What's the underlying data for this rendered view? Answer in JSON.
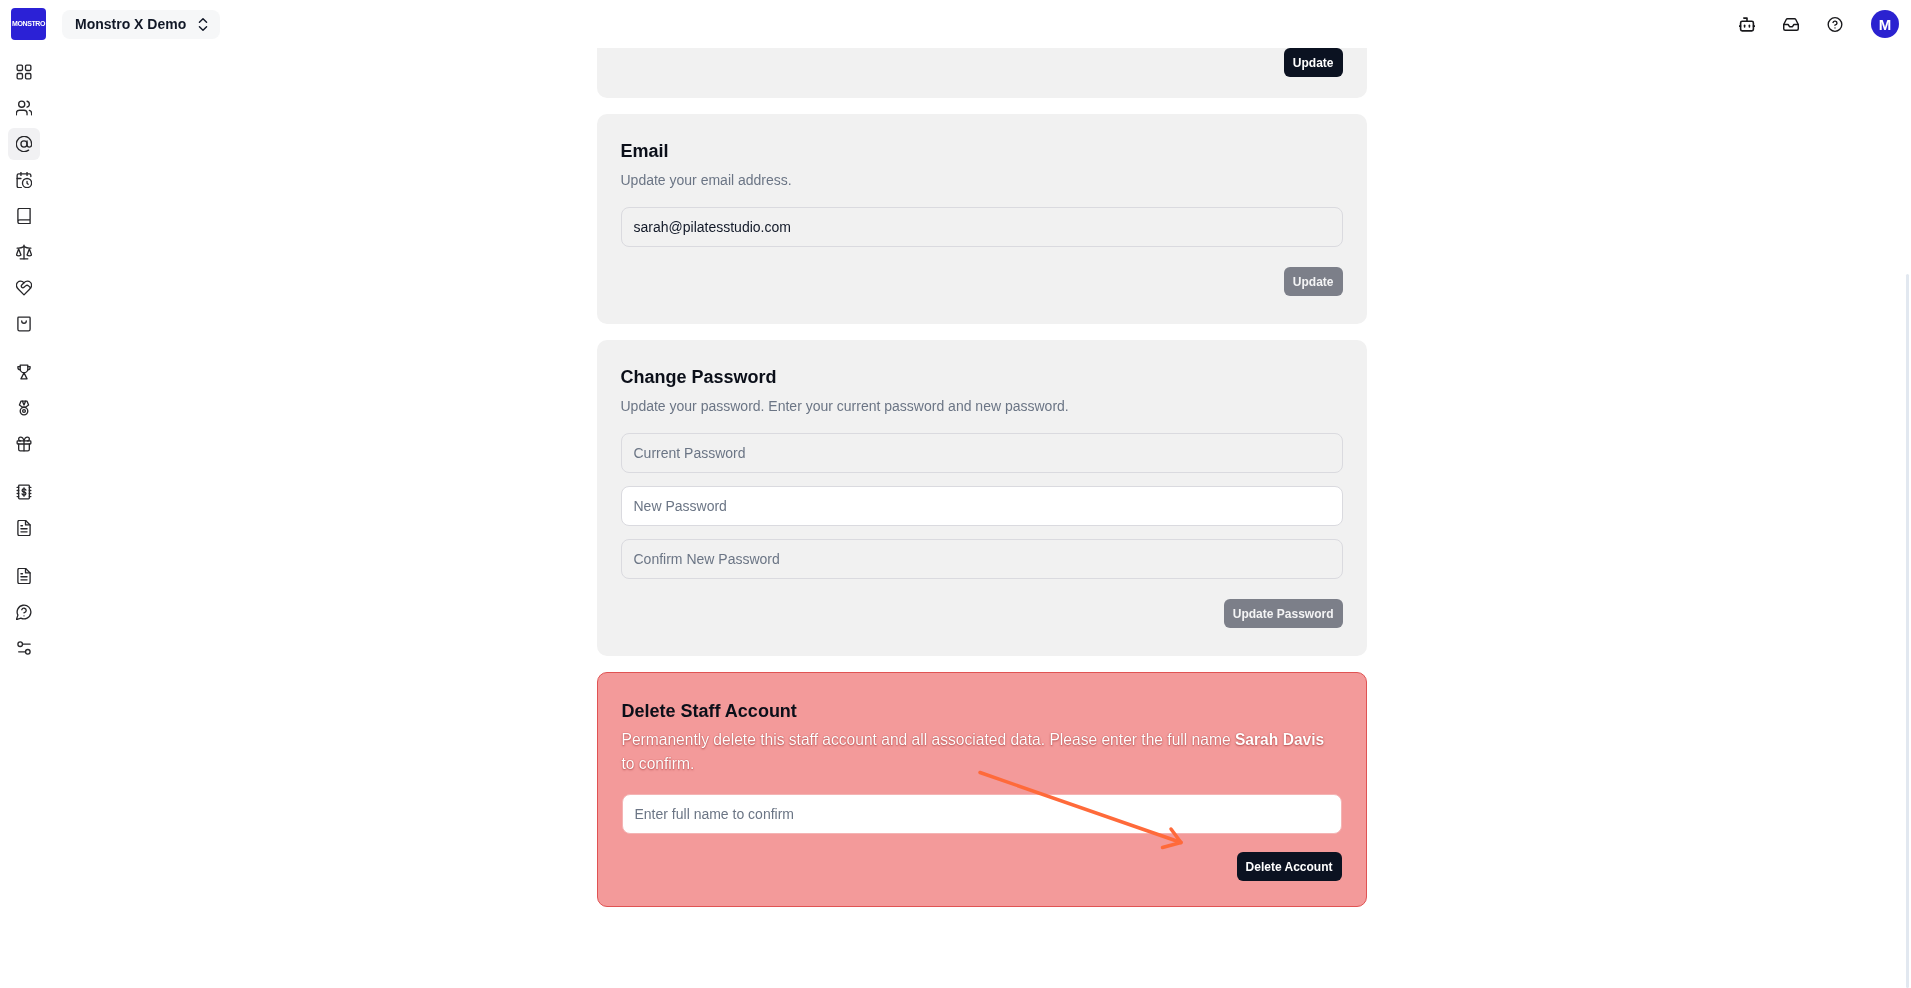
{
  "header": {
    "logo": "MONSTRO",
    "project": "Monstro X Demo",
    "avatar": "M"
  },
  "sidebar": {
    "groups": [
      {
        "items": [
          {
            "selected": false
          },
          {
            "selected": false
          },
          {
            "selected": true
          },
          {
            "selected": false
          },
          {
            "selected": false
          },
          {
            "selected": false
          },
          {
            "selected": false
          },
          {
            "selected": false
          }
        ]
      },
      {
        "items": [
          {
            "selected": false
          },
          {
            "selected": false
          },
          {
            "selected": false
          }
        ]
      },
      {
        "items": [
          {
            "selected": false
          },
          {
            "selected": false
          }
        ]
      },
      {
        "items": [
          {
            "selected": false
          },
          {
            "selected": false
          },
          {
            "selected": false
          }
        ]
      }
    ]
  },
  "sections": [
    {
      "kind": "form",
      "button": {
        "label": "Update",
        "disabled": false
      }
    },
    {
      "kind": "form",
      "title": "Email",
      "description": "Update your email address.",
      "fields": [
        {
          "value": "sarah@pilatesstudio.com",
          "focused": false
        }
      ],
      "button": {
        "label": "Update",
        "disabled": true
      }
    },
    {
      "kind": "form",
      "title": "Change Password",
      "description": "Update your password. Enter your current password and new password.",
      "fields": [
        {
          "placeholder": "Current Password",
          "focused": false
        },
        {
          "placeholder": "New Password",
          "focused": true
        },
        {
          "placeholder": "Confirm New Password",
          "focused": false
        }
      ],
      "button": {
        "label": "Update Password",
        "disabled": true
      }
    },
    {
      "kind": "danger",
      "title": "Delete Staff Account",
      "description": "Permanently delete this staff account and all associated data. Please enter the full name **Sarah Davis** to confirm.",
      "fields": [
        {
          "placeholder": "Enter full name to confirm"
        }
      ],
      "button": {
        "label": "Delete Account",
        "disabled": false
      },
      "arrow_annotation": true
    }
  ]
}
